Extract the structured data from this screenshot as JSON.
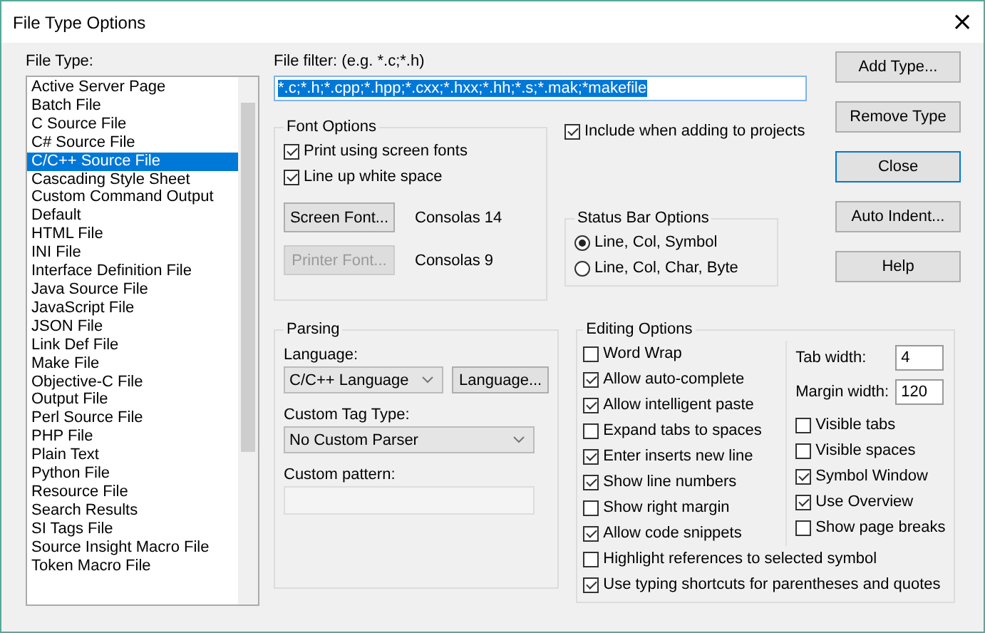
{
  "window": {
    "title": "File Type Options",
    "close": "×"
  },
  "file_type": {
    "label": "File Type:",
    "items": [
      {
        "label": "Active Server Page",
        "selected": false
      },
      {
        "label": "Batch File",
        "selected": false
      },
      {
        "label": "C Source File",
        "selected": false
      },
      {
        "label": "C# Source File",
        "selected": false
      },
      {
        "label": "C/C++ Source File",
        "selected": true
      },
      {
        "label": "Cascading Style Sheet",
        "selected": false
      },
      {
        "label": "Custom Command Output",
        "selected": false
      },
      {
        "label": "Default",
        "selected": false
      },
      {
        "label": "HTML File",
        "selected": false
      },
      {
        "label": "INI File",
        "selected": false
      },
      {
        "label": "Interface Definition File",
        "selected": false
      },
      {
        "label": "Java Source File",
        "selected": false
      },
      {
        "label": "JavaScript File",
        "selected": false
      },
      {
        "label": "JSON File",
        "selected": false
      },
      {
        "label": "Link Def File",
        "selected": false
      },
      {
        "label": "Make File",
        "selected": false
      },
      {
        "label": "Objective-C File",
        "selected": false
      },
      {
        "label": "Output File",
        "selected": false
      },
      {
        "label": "Perl Source File",
        "selected": false
      },
      {
        "label": "PHP File",
        "selected": false
      },
      {
        "label": "Plain Text",
        "selected": false
      },
      {
        "label": "Python File",
        "selected": false
      },
      {
        "label": "Resource File",
        "selected": false
      },
      {
        "label": "Search Results",
        "selected": false
      },
      {
        "label": "SI Tags File",
        "selected": false
      },
      {
        "label": "Source Insight Macro File",
        "selected": false
      },
      {
        "label": "Token Macro File",
        "selected": false
      }
    ]
  },
  "file_filter": {
    "label": "File filter: (e.g. *.c;*.h)",
    "value": "*.c;*.h;*.cpp;*.hpp;*.cxx;*.hxx;*.hh;*.s;*.mak;*makefile"
  },
  "font_options": {
    "title": "Font Options",
    "checkboxes": [
      {
        "label": "Print using screen fonts",
        "checked": true
      },
      {
        "label": "Line up white space",
        "checked": true
      }
    ],
    "fonts": [
      {
        "button": "Screen Font...",
        "disabled": false,
        "value": "Consolas 14"
      },
      {
        "button": "Printer Font...",
        "disabled": true,
        "value": "Consolas 9"
      }
    ]
  },
  "include_in_projects": {
    "label": "Include when adding to projects",
    "checked": true
  },
  "status_bar_options": {
    "title": "Status Bar Options",
    "radios": [
      {
        "label": "Line, Col, Symbol",
        "selected": true
      },
      {
        "label": "Line, Col, Char, Byte",
        "selected": false
      }
    ]
  },
  "parsing": {
    "title": "Parsing",
    "language_label": "Language:",
    "language": "C/C++ Language",
    "language_button": "Language...",
    "tag_type_label": "Custom Tag Type:",
    "tag_type": "No Custom Parser",
    "pattern_label": "Custom pattern:"
  },
  "editing_options": {
    "title": "Editing Options",
    "left": [
      {
        "label": "Word Wrap",
        "checked": false
      },
      {
        "label": "Allow auto-complete",
        "checked": true
      },
      {
        "label": "Allow intelligent paste",
        "checked": true
      },
      {
        "label": "Expand tabs to spaces",
        "checked": false
      },
      {
        "label": "Enter inserts new line",
        "checked": true
      },
      {
        "label": "Show line numbers",
        "checked": true
      },
      {
        "label": "Show right margin",
        "checked": false
      },
      {
        "label": "Allow code snippets",
        "checked": true
      }
    ],
    "fields": [
      {
        "label": "Tab width:",
        "value": "4"
      },
      {
        "label": "Margin width:",
        "value": "120"
      }
    ],
    "right": [
      {
        "label": "Visible tabs",
        "checked": false
      },
      {
        "label": "Visible spaces",
        "checked": false
      },
      {
        "label": "Symbol Window",
        "checked": true
      },
      {
        "label": "Use Overview",
        "checked": true
      },
      {
        "label": "Show page breaks",
        "checked": false
      }
    ],
    "bottom": [
      {
        "label": "Highlight references to selected symbol",
        "checked": false
      },
      {
        "label": "Use typing shortcuts for parentheses and quotes",
        "checked": true
      }
    ]
  },
  "buttons": [
    {
      "label": "Add Type...",
      "default": false
    },
    {
      "label": "Remove Type",
      "default": false
    },
    {
      "label": "Close",
      "default": true
    },
    {
      "label": "Auto Indent...",
      "default": false
    },
    {
      "label": "Help",
      "default": false
    }
  ]
}
